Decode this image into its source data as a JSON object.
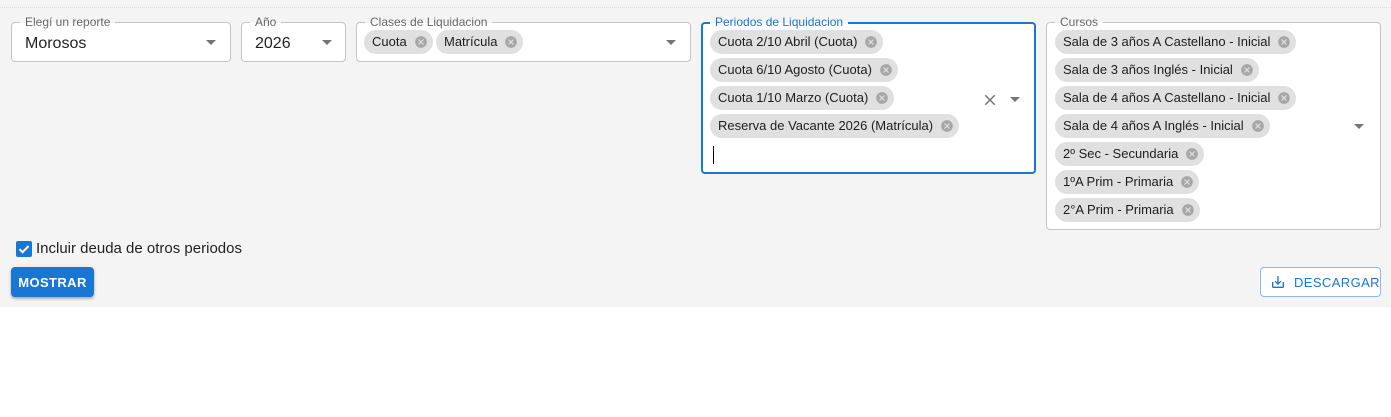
{
  "filters": {
    "reporte": {
      "label": "Elegí un reporte",
      "value": "Morosos"
    },
    "anio": {
      "label": "Año",
      "value": "2026"
    },
    "clases": {
      "label": "Clases de Liquidacion",
      "chips": [
        "Cuota",
        "Matrícula"
      ]
    },
    "periodos": {
      "label": "Periodos de Liquidacion",
      "chips": [
        "Cuota 2/10 Abril (Cuota)",
        "Cuota 6/10 Agosto (Cuota)",
        "Cuota 1/10 Marzo (Cuota)",
        "Reserva de Vacante 2026 (Matrícula)"
      ]
    },
    "cursos": {
      "label": "Cursos",
      "chips": [
        "Sala de 3 años A Castellano - Inicial",
        "Sala de 3 años Inglés - Inicial",
        "Sala de 4 años A Castellano - Inicial",
        "Sala de 4 años A Inglés - Inicial",
        "2º Sec - Secundaria",
        "1ºA Prim - Primaria",
        "2°A Prim - Primaria"
      ]
    }
  },
  "checkbox": {
    "label": "Incluir deuda de otros periodos",
    "checked": true
  },
  "buttons": {
    "mostrar": "MOSTRAR",
    "descargar": "DESCARGAR"
  },
  "icons": {
    "arrow": "arrow-drop-down-icon",
    "chip_delete": "cancel-icon",
    "clear": "close-icon",
    "download": "download-icon",
    "check": "checkbox-checked-icon"
  },
  "colors": {
    "primary": "#1976d2",
    "chip": "#e0e0e0",
    "panel": "#f4f4f4"
  }
}
